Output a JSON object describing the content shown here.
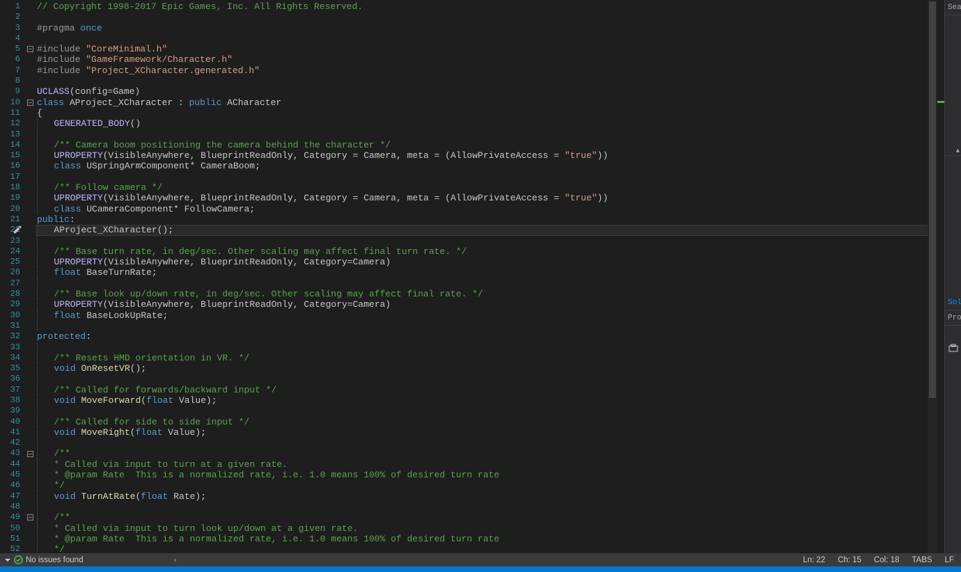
{
  "status": {
    "issues": "No issues found",
    "line": "Ln: 22",
    "char": "Ch: 15",
    "col": "Col: 18",
    "tabs": "TABS",
    "lineend": "LF"
  },
  "sidepanel": {
    "search": "Sear",
    "solution": "Solut",
    "properties": "Prop"
  },
  "code": [
    {
      "n": 1,
      "t": "comment",
      "v": "// Copyright 1998-2017 Epic Games, Inc. All Rights Reserved."
    },
    {
      "n": 2,
      "t": "blank",
      "v": ""
    },
    {
      "n": 3,
      "t": "pragma",
      "v": "#pragma once"
    },
    {
      "n": 4,
      "t": "blank",
      "v": ""
    },
    {
      "n": 5,
      "t": "include",
      "v": "#include \"CoreMinimal.h\"",
      "fold": "minus"
    },
    {
      "n": 6,
      "t": "include",
      "v": "#include \"GameFramework/Character.h\""
    },
    {
      "n": 7,
      "t": "include",
      "v": "#include \"Project_XCharacter.generated.h\""
    },
    {
      "n": 8,
      "t": "blank",
      "v": ""
    },
    {
      "n": 9,
      "t": "uclass",
      "v": "UCLASS(config=Game)"
    },
    {
      "n": 10,
      "t": "classdecl",
      "v": "class AProject_XCharacter : public ACharacter",
      "fold": "minus"
    },
    {
      "n": 11,
      "t": "brace",
      "v": "{"
    },
    {
      "n": 12,
      "t": "genbody",
      "v": "    GENERATED_BODY()"
    },
    {
      "n": 13,
      "t": "blank2",
      "v": ""
    },
    {
      "n": 14,
      "t": "comment2",
      "v": "    /** Camera boom positioning the camera behind the character */"
    },
    {
      "n": 15,
      "t": "uprop",
      "v": "    UPROPERTY(VisibleAnywhere, BlueprintReadOnly, Category = Camera, meta = (AllowPrivateAccess = \"true\"))"
    },
    {
      "n": 16,
      "t": "member",
      "v": "    class USpringArmComponent* CameraBoom;"
    },
    {
      "n": 17,
      "t": "blank2",
      "v": ""
    },
    {
      "n": 18,
      "t": "comment2",
      "v": "    /** Follow camera */"
    },
    {
      "n": 19,
      "t": "uprop",
      "v": "    UPROPERTY(VisibleAnywhere, BlueprintReadOnly, Category = Camera, meta = (AllowPrivateAccess = \"true\"))"
    },
    {
      "n": 20,
      "t": "member",
      "v": "    class UCameraComponent* FollowCamera;"
    },
    {
      "n": 21,
      "t": "access",
      "v": "public:"
    },
    {
      "n": 22,
      "t": "ctor",
      "v": "    AProject_XCharacter();",
      "hl": true
    },
    {
      "n": 23,
      "t": "blank2",
      "v": ""
    },
    {
      "n": 24,
      "t": "comment2",
      "v": "    /** Base turn rate, in deg/sec. Other scaling may affect final turn rate. */"
    },
    {
      "n": 25,
      "t": "uprop2",
      "v": "    UPROPERTY(VisibleAnywhere, BlueprintReadOnly, Category=Camera)"
    },
    {
      "n": 26,
      "t": "floatmem",
      "v": "    float BaseTurnRate;"
    },
    {
      "n": 27,
      "t": "blank2",
      "v": ""
    },
    {
      "n": 28,
      "t": "comment2",
      "v": "    /** Base look up/down rate, in deg/sec. Other scaling may affect final rate. */"
    },
    {
      "n": 29,
      "t": "uprop2",
      "v": "    UPROPERTY(VisibleAnywhere, BlueprintReadOnly, Category=Camera)"
    },
    {
      "n": 30,
      "t": "floatmem",
      "v": "    float BaseLookUpRate;"
    },
    {
      "n": 31,
      "t": "blank2",
      "v": ""
    },
    {
      "n": 32,
      "t": "access",
      "v": "protected:"
    },
    {
      "n": 33,
      "t": "blank2",
      "v": ""
    },
    {
      "n": 34,
      "t": "comment2",
      "v": "    /** Resets HMD orientation in VR. */"
    },
    {
      "n": 35,
      "t": "voidfn",
      "v": "    void OnResetVR();"
    },
    {
      "n": 36,
      "t": "blank2",
      "v": ""
    },
    {
      "n": 37,
      "t": "comment2",
      "v": "    /** Called for forwards/backward input */"
    },
    {
      "n": 38,
      "t": "voidfnp",
      "v": "    void MoveForward(float Value);"
    },
    {
      "n": 39,
      "t": "blank2",
      "v": ""
    },
    {
      "n": 40,
      "t": "comment2",
      "v": "    /** Called for side to side input */"
    },
    {
      "n": 41,
      "t": "voidfnp",
      "v": "    void MoveRight(float Value);"
    },
    {
      "n": 42,
      "t": "blank2",
      "v": ""
    },
    {
      "n": 43,
      "t": "comment2",
      "v": "    /**",
      "fold": "minus"
    },
    {
      "n": 44,
      "t": "comment2",
      "v": "     * Called via input to turn at a given rate."
    },
    {
      "n": 45,
      "t": "comment2",
      "v": "     * @param Rate  This is a normalized rate, i.e. 1.0 means 100% of desired turn rate"
    },
    {
      "n": 46,
      "t": "comment2",
      "v": "     */"
    },
    {
      "n": 47,
      "t": "voidfnp",
      "v": "    void TurnAtRate(float Rate);"
    },
    {
      "n": 48,
      "t": "blank2",
      "v": ""
    },
    {
      "n": 49,
      "t": "comment2",
      "v": "    /**",
      "fold": "minus"
    },
    {
      "n": 50,
      "t": "comment2",
      "v": "     * Called via input to turn look up/down at a given rate."
    },
    {
      "n": 51,
      "t": "comment2",
      "v": "     * @param Rate  This is a normalized rate, i.e. 1.0 means 100% of desired turn rate"
    },
    {
      "n": 52,
      "t": "comment2",
      "v": "     */"
    }
  ]
}
